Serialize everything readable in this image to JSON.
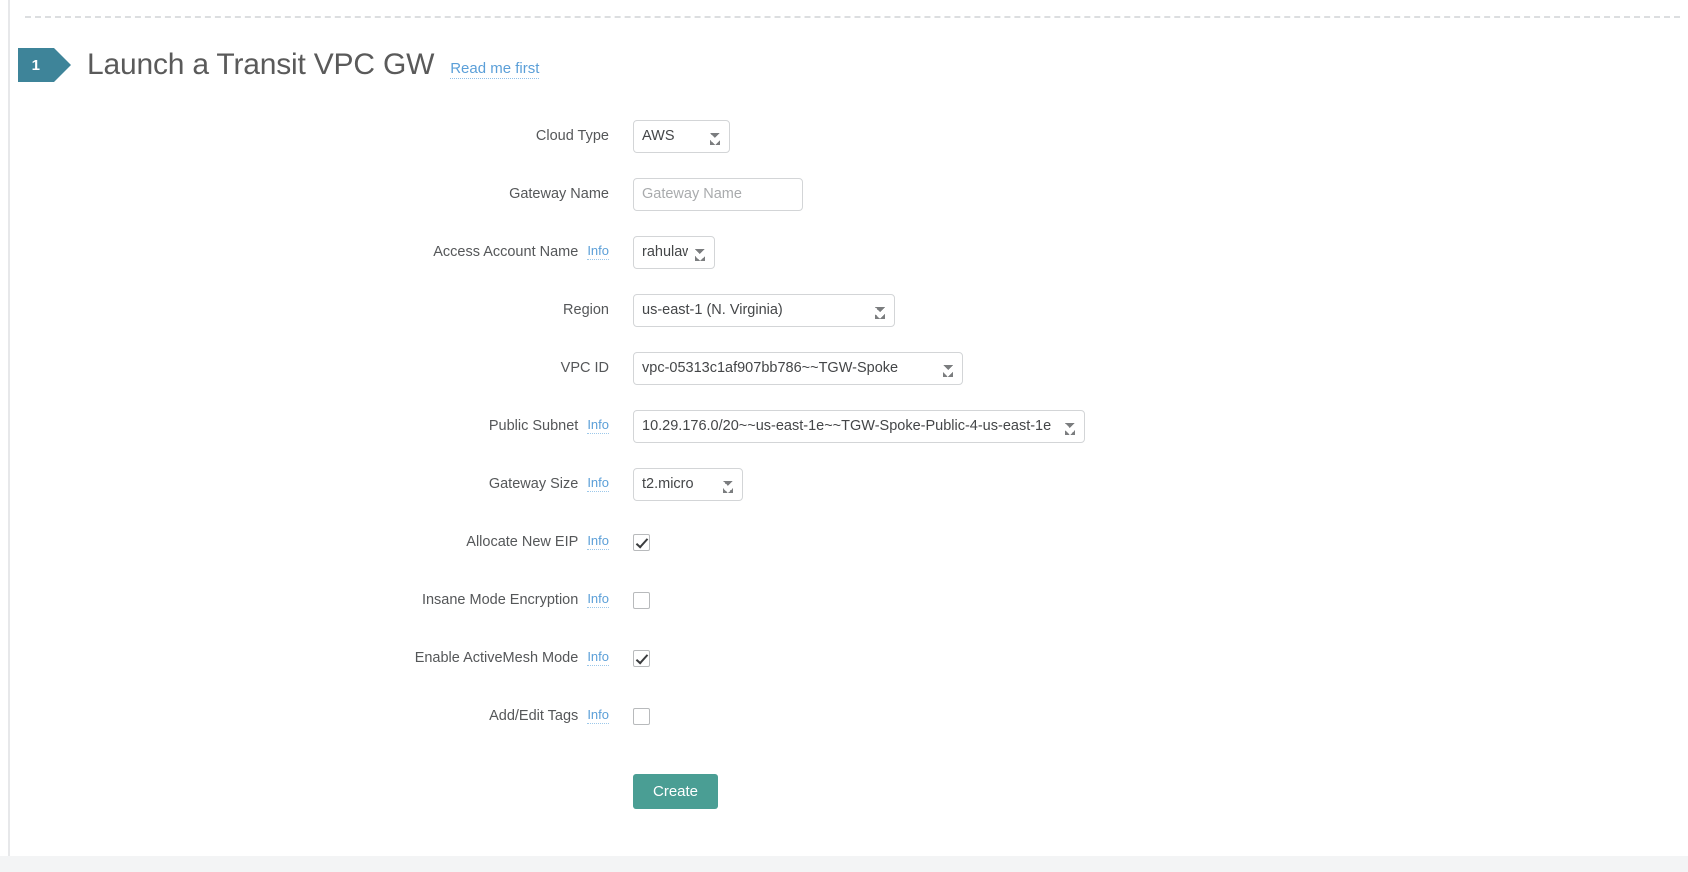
{
  "header": {
    "step_number": "1",
    "title": "Launch a Transit VPC GW",
    "readme_label": "Read me first"
  },
  "colors": {
    "step_badge": "#3e8499",
    "link": "#5b9fd8",
    "create_button": "#4a9e94",
    "label_text": "#555759"
  },
  "common": {
    "info_label": "Info"
  },
  "form": {
    "rows": [
      {
        "label": "Cloud Type",
        "has_info": false,
        "control": "select",
        "value": "AWS"
      },
      {
        "label": "Gateway Name",
        "has_info": false,
        "control": "text",
        "value": "",
        "placeholder": "Gateway Name"
      },
      {
        "label": "Access Account Name",
        "has_info": true,
        "control": "select",
        "value": "rahulaws"
      },
      {
        "label": "Region",
        "has_info": false,
        "control": "select",
        "value": "us-east-1 (N. Virginia)"
      },
      {
        "label": "VPC ID",
        "has_info": false,
        "control": "select",
        "value": "vpc-05313c1af907bb786~~TGW-Spoke"
      },
      {
        "label": "Public Subnet",
        "has_info": true,
        "control": "select",
        "value": "10.29.176.0/20~~us-east-1e~~TGW-Spoke-Public-4-us-east-1e"
      },
      {
        "label": "Gateway Size",
        "has_info": true,
        "control": "select",
        "value": "t2.micro"
      },
      {
        "label": "Allocate New EIP",
        "has_info": true,
        "control": "checkbox",
        "checked": true
      },
      {
        "label": "Insane Mode Encryption",
        "has_info": true,
        "control": "checkbox",
        "checked": false
      },
      {
        "label": "Enable ActiveMesh Mode",
        "has_info": true,
        "control": "checkbox",
        "checked": true
      },
      {
        "label": "Add/Edit Tags",
        "has_info": true,
        "control": "checkbox",
        "checked": false
      }
    ],
    "submit_label": "Create"
  }
}
